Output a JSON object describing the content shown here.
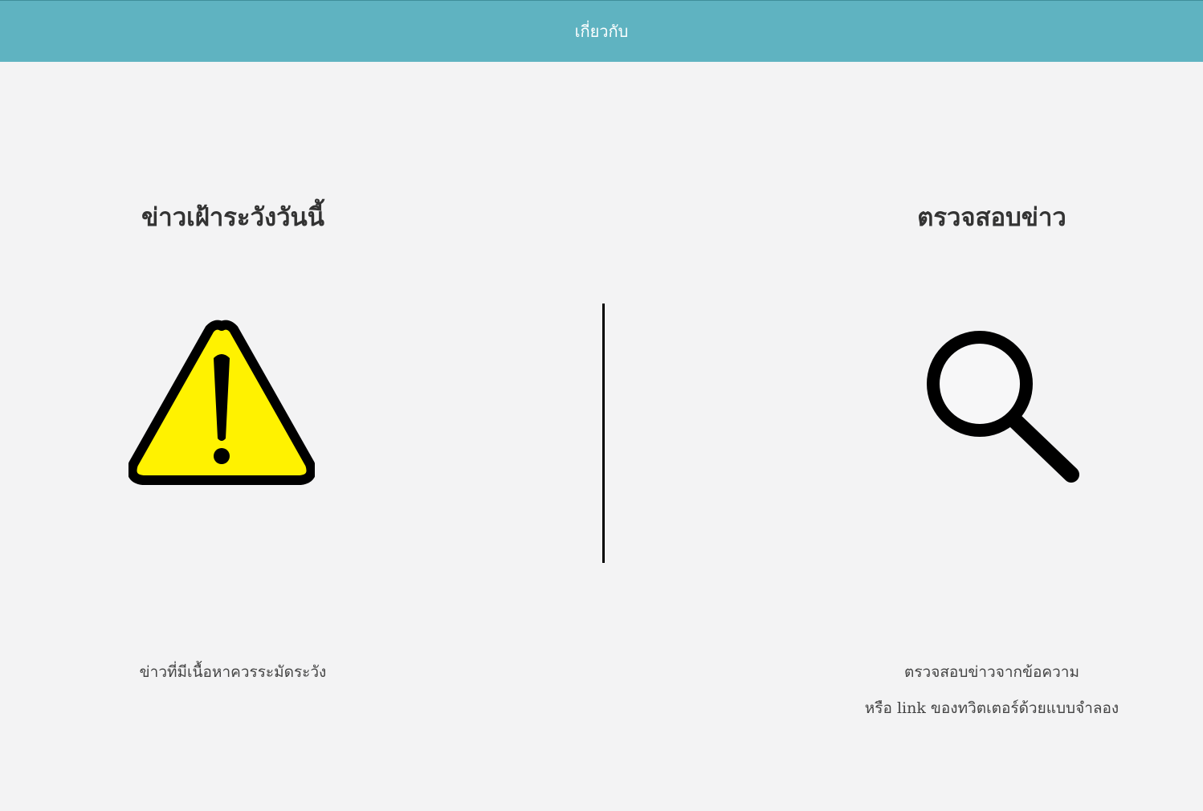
{
  "header": {
    "nav_label": "เกี่ยวกับ",
    "background_color": "#5fb3c1"
  },
  "left_panel": {
    "title": "ข่าวเฝ้าระวังวันนี้",
    "icon": "warning-triangle-icon",
    "icon_fill_color": "#ffff00",
    "description": "ข่าวที่มีเนื้อหาควรระมัดระวัง"
  },
  "right_panel": {
    "title": "ตรวจสอบข่าว",
    "icon": "magnifier-icon",
    "description_line1": "ตรวจสอบข่าวจากข้อความ",
    "description_line2": "หรือ link ของทวิตเตอร์ด้วยแบบจำลอง"
  }
}
